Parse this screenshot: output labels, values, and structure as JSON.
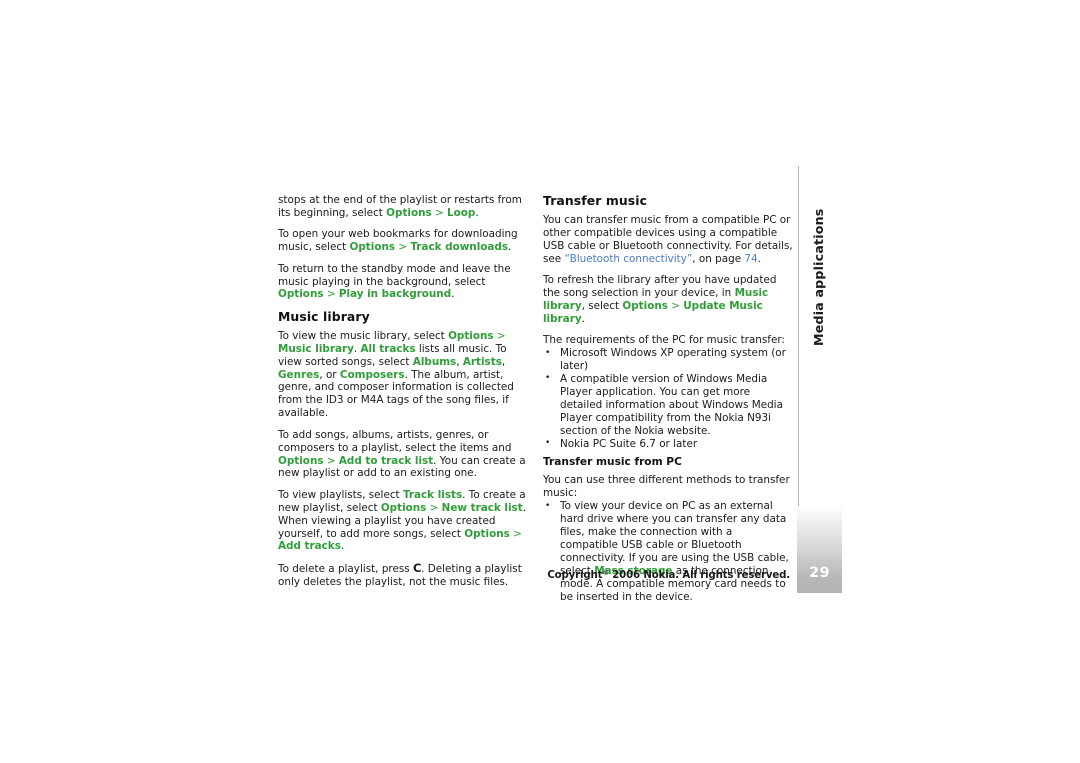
{
  "document": {
    "page_number": "29",
    "side_tab_label": "Media applications",
    "footer": {
      "copyright_prefix": "Copyright",
      "copyright_symbol": "©",
      "copyright_rest": " 2006 Nokia. All rights reserved."
    }
  },
  "left_column": {
    "para_loop": {
      "t1": "stops at the end of the playlist or restarts from its beginning, select ",
      "opt": "Options",
      "sep": " > ",
      "val": "Loop",
      "t2": "."
    },
    "para_bookmarks": {
      "t1": "To open your web bookmarks for downloading music, select ",
      "opt": "Options",
      "sep": " > ",
      "val": "Track downloads",
      "t2": "."
    },
    "para_standby": {
      "t1": "To return to the standby mode and leave the music playing in the background, select ",
      "opt": "Options",
      "sep": " > ",
      "val": "Play in background",
      "t2": "."
    },
    "heading_music_library": "Music library",
    "para_view_library": {
      "t1": "To view the music library, select ",
      "opt": "Options",
      "sep": " > ",
      "val": "Music library",
      "t2": ". ",
      "val2": "All tracks",
      "t3": " lists all music. To view sorted songs, select ",
      "val3": "Albums",
      "t4": ", ",
      "val4": "Artists",
      "t5": ", ",
      "val5": "Genres",
      "t6": ", or ",
      "val6": "Composers",
      "t7": ". The album, artist, genre, and composer information is collected from the ID3 or M4A tags of the song files, if available."
    },
    "para_add_songs": {
      "t1": "To add songs, albums, artists, genres, or composers to a playlist, select the items and ",
      "opt": "Options",
      "sep": " > ",
      "val": "Add to track list",
      "t2": ". You can create a new playlist or add to an existing one."
    },
    "para_view_playlists": {
      "t1": "To view playlists, select ",
      "val0": "Track lists",
      "t2": ". To create a new playlist, select ",
      "opt": "Options",
      "sep": " > ",
      "val": "New track list",
      "t3": ". When viewing a playlist you have created yourself, to add more songs, select ",
      "opt2": "Options",
      "sep2": " > ",
      "val2": "Add tracks",
      "t4": "."
    },
    "para_delete_playlist": {
      "t1": "To delete a playlist, press ",
      "key": "C",
      "t2": ". Deleting a playlist only deletes the playlist, not the music files."
    }
  },
  "right_column": {
    "heading_transfer_music": "Transfer music",
    "para_transfer_intro": {
      "t1": "You can transfer music from a compatible PC or other compatible devices using a compatible USB cable or Bluetooth connectivity. For details, see ",
      "link": "“Bluetooth connectivity”",
      "t2": ", on page ",
      "page_link": "74",
      "t3": "."
    },
    "para_refresh": {
      "t1": "To refresh the library after you have updated the song selection in your device, in ",
      "val": "Music library",
      "t2": ", select ",
      "opt": "Options",
      "sep": " > ",
      "val2": "Update Music library",
      "t3": "."
    },
    "requirements_intro": "The requirements of the PC for music transfer:",
    "requirements": [
      "Microsoft Windows XP operating system (or later)",
      "A compatible version of Windows Media Player application. You can get more detailed information about Windows Media Player compatibility from the Nokia N93i section of the Nokia website.",
      "Nokia PC Suite 6.7 or later"
    ],
    "subheading_transfer_from_pc": "Transfer music from PC",
    "methods_intro": "You can use three different methods to transfer music:",
    "method_1": {
      "t1": "To view your device on PC as an external hard drive where you can transfer any data files, make the connection with a compatible USB cable or Bluetooth connectivity. If you are using the USB cable, select ",
      "val": "Mass storage",
      "t2": " as the connection mode. A compatible memory card needs to be inserted in the device."
    }
  },
  "colors": {
    "accent_green": "#2f9e38",
    "link_blue": "#4b7fbe",
    "text": "#1a1a1a",
    "rail_gray": "#b9b9b9"
  }
}
